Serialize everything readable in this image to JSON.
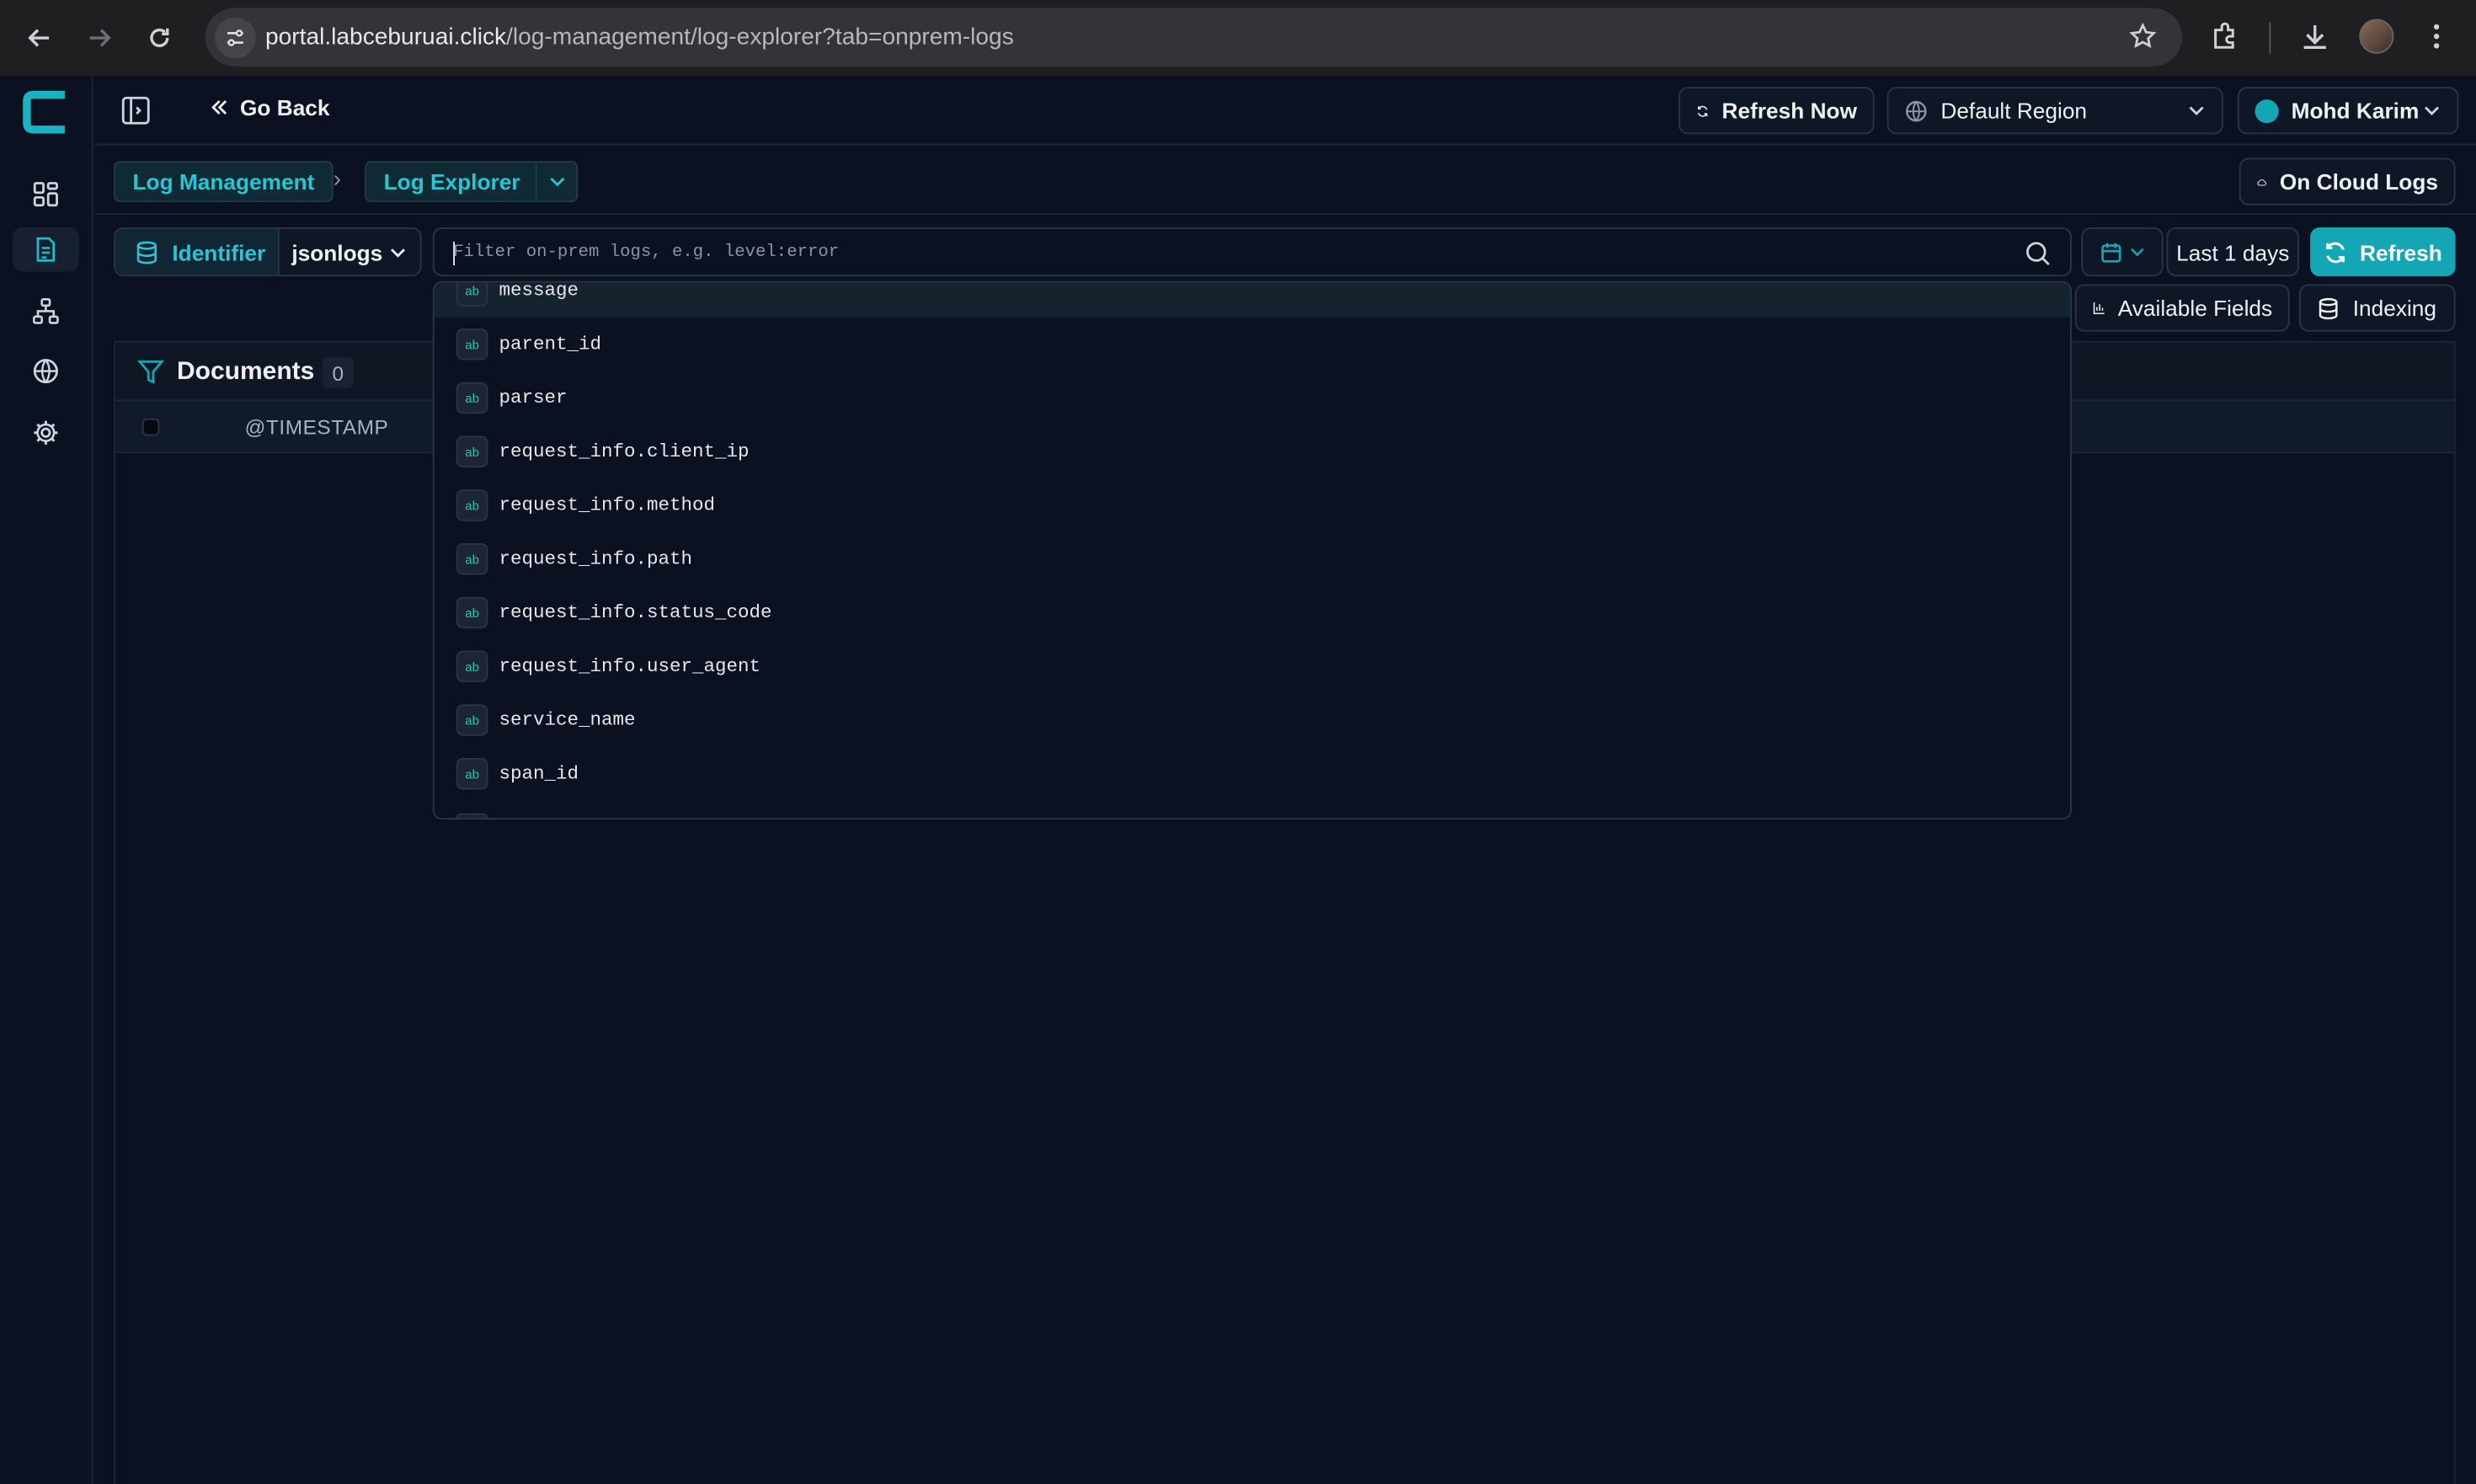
{
  "browser": {
    "url_host": "portal.labceburuai.click",
    "url_path": "/log-management/log-explorer?tab=onprem-logs"
  },
  "topbar": {
    "go_back_label": "Go Back",
    "refresh_now_label": "Refresh Now",
    "region_label": "Default Region",
    "user_name": "Mohd Karim"
  },
  "breadcrumb": {
    "root_label": "Log Management",
    "current_label": "Log Explorer",
    "separator": "›"
  },
  "on_cloud_logs_label": "On Cloud Logs",
  "query": {
    "identifier_label": "Identifier",
    "index_value": "jsonlogs",
    "search_placeholder": "Filter on-prem logs, e.g. level:error",
    "time_range_label": "Last 1 days",
    "refresh_label": "Refresh"
  },
  "tools": {
    "available_fields_label": "Available Fields",
    "indexing_label": "Indexing"
  },
  "documents": {
    "title": "Documents",
    "count": "0",
    "column_timestamp": "@TIMESTAMP"
  },
  "suggestions": {
    "type_badge": "ab",
    "items": [
      "message",
      "parent_id",
      "parser",
      "request_info.client_ip",
      "request_info.method",
      "request_info.path",
      "request_info.status_code",
      "request_info.user_agent",
      "service_name",
      "span_id"
    ]
  },
  "colors": {
    "accent": "#14a6b5",
    "background": "#0b1120",
    "border": "#2b3445"
  }
}
